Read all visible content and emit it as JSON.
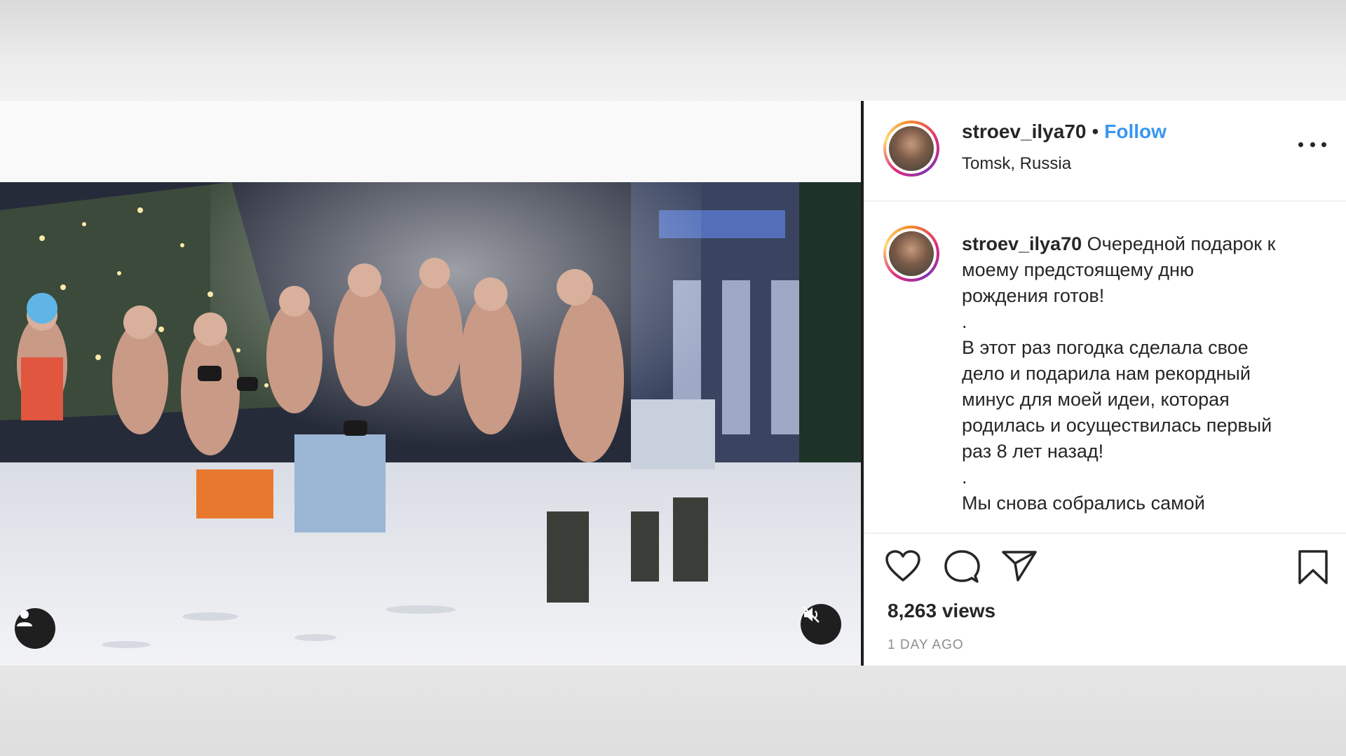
{
  "post": {
    "username": "stroev_ilya70",
    "separator": "•",
    "follow_label": "Follow",
    "location": "Tomsk, Russia",
    "more_icon": "more-horizontal-icon"
  },
  "caption": {
    "username": "stroev_ilya70",
    "lines": [
      "Очередной подарок к",
      "моему предстоящему дню",
      "рождения готов!",
      ".",
      "В этот раз погодка сделала свое",
      "дело и подарила нам рекордный",
      "минус для моей идеи, которая",
      "родилась и осуществилась первый",
      "раз 8 лет назад!",
      ".",
      "Мы снова собрались самой"
    ]
  },
  "actions": {
    "like_icon": "heart-icon",
    "comment_icon": "comment-icon",
    "share_icon": "paper-plane-icon",
    "save_icon": "bookmark-icon"
  },
  "stats": {
    "views": "8,263 views",
    "time_ago": "1 DAY AGO"
  },
  "video": {
    "tag_icon": "user-tag-icon",
    "mute_icon": "muted-speaker-icon"
  },
  "colors": {
    "follow": "#3897f0",
    "text": "#262626",
    "muted_text": "#8e8e8e"
  }
}
